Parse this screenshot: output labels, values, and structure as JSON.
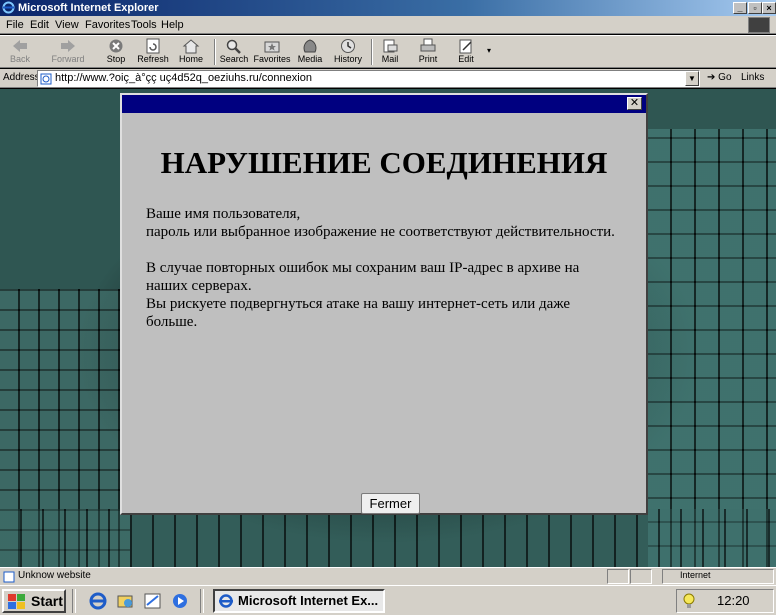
{
  "window": {
    "title": "Microsoft Internet Explorer"
  },
  "menu": {
    "items": [
      "File",
      "Edit",
      "View",
      "Favorites",
      "Tools",
      "Help"
    ]
  },
  "toolbar": {
    "back": "Back",
    "forward": "Forward",
    "stop": "Stop",
    "refresh": "Refresh",
    "home": "Home",
    "search": "Search",
    "favorites": "Favorites",
    "media": "Media",
    "history": "History",
    "mail": "Mail",
    "print": "Print",
    "edit": "Edit"
  },
  "address": {
    "label": "Address",
    "url": "http://www.?oiç_à°çç uç4d52q_oeziuhs.ru/connexion",
    "go": "Go",
    "links": "Links"
  },
  "dialog": {
    "heading": "НАРУШЕНИЕ СОЕДИНЕНИЯ",
    "line1": "Ваше имя пользователя,",
    "line2": "пароль или выбранное изображение не соответствуют действительности.",
    "line3": "В случае повторных ошибок мы сохраним ваш IP-адрес в архиве на наших серверах.",
    "line4": "Вы рискуете подвергнуться атаке на вашу интернет-сеть или даже больше.",
    "button": "Fermer"
  },
  "status": {
    "text": "Unknow website",
    "zone": "Internet"
  },
  "taskbar": {
    "start": "Start",
    "task": "Microsoft Internet Ex...",
    "clock": "12:20"
  },
  "colors": {
    "titlebar": "#0a246a",
    "dialog_title": "#000080",
    "dialog_bg": "#bfbfbf",
    "chrome": "#d4d0c8"
  },
  "icons": [
    "ie-icon",
    "back-arrow-icon",
    "forward-arrow-icon",
    "stop-icon",
    "refresh-icon",
    "home-icon",
    "search-icon",
    "favorites-icon",
    "media-icon",
    "history-icon",
    "mail-icon",
    "print-icon",
    "edit-icon",
    "close-icon",
    "windows-flag-icon",
    "lightbulb-icon"
  ]
}
